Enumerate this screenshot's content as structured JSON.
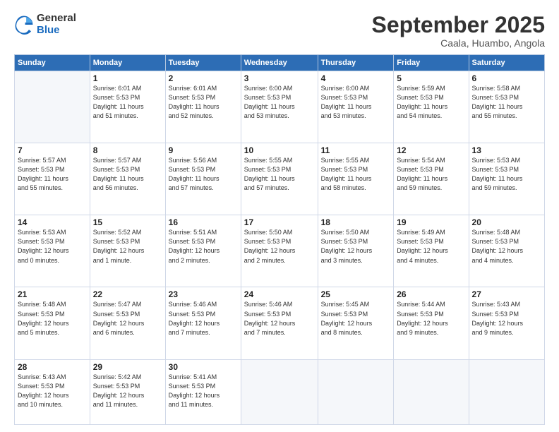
{
  "logo": {
    "general": "General",
    "blue": "Blue"
  },
  "title": "September 2025",
  "subtitle": "Caala, Huambo, Angola",
  "days_of_week": [
    "Sunday",
    "Monday",
    "Tuesday",
    "Wednesday",
    "Thursday",
    "Friday",
    "Saturday"
  ],
  "weeks": [
    [
      {
        "day": "",
        "info": ""
      },
      {
        "day": "1",
        "info": "Sunrise: 6:01 AM\nSunset: 5:53 PM\nDaylight: 11 hours\nand 51 minutes."
      },
      {
        "day": "2",
        "info": "Sunrise: 6:01 AM\nSunset: 5:53 PM\nDaylight: 11 hours\nand 52 minutes."
      },
      {
        "day": "3",
        "info": "Sunrise: 6:00 AM\nSunset: 5:53 PM\nDaylight: 11 hours\nand 53 minutes."
      },
      {
        "day": "4",
        "info": "Sunrise: 6:00 AM\nSunset: 5:53 PM\nDaylight: 11 hours\nand 53 minutes."
      },
      {
        "day": "5",
        "info": "Sunrise: 5:59 AM\nSunset: 5:53 PM\nDaylight: 11 hours\nand 54 minutes."
      },
      {
        "day": "6",
        "info": "Sunrise: 5:58 AM\nSunset: 5:53 PM\nDaylight: 11 hours\nand 55 minutes."
      }
    ],
    [
      {
        "day": "7",
        "info": "Sunrise: 5:57 AM\nSunset: 5:53 PM\nDaylight: 11 hours\nand 55 minutes."
      },
      {
        "day": "8",
        "info": "Sunrise: 5:57 AM\nSunset: 5:53 PM\nDaylight: 11 hours\nand 56 minutes."
      },
      {
        "day": "9",
        "info": "Sunrise: 5:56 AM\nSunset: 5:53 PM\nDaylight: 11 hours\nand 57 minutes."
      },
      {
        "day": "10",
        "info": "Sunrise: 5:55 AM\nSunset: 5:53 PM\nDaylight: 11 hours\nand 57 minutes."
      },
      {
        "day": "11",
        "info": "Sunrise: 5:55 AM\nSunset: 5:53 PM\nDaylight: 11 hours\nand 58 minutes."
      },
      {
        "day": "12",
        "info": "Sunrise: 5:54 AM\nSunset: 5:53 PM\nDaylight: 11 hours\nand 59 minutes."
      },
      {
        "day": "13",
        "info": "Sunrise: 5:53 AM\nSunset: 5:53 PM\nDaylight: 11 hours\nand 59 minutes."
      }
    ],
    [
      {
        "day": "14",
        "info": "Sunrise: 5:53 AM\nSunset: 5:53 PM\nDaylight: 12 hours\nand 0 minutes."
      },
      {
        "day": "15",
        "info": "Sunrise: 5:52 AM\nSunset: 5:53 PM\nDaylight: 12 hours\nand 1 minute."
      },
      {
        "day": "16",
        "info": "Sunrise: 5:51 AM\nSunset: 5:53 PM\nDaylight: 12 hours\nand 2 minutes."
      },
      {
        "day": "17",
        "info": "Sunrise: 5:50 AM\nSunset: 5:53 PM\nDaylight: 12 hours\nand 2 minutes."
      },
      {
        "day": "18",
        "info": "Sunrise: 5:50 AM\nSunset: 5:53 PM\nDaylight: 12 hours\nand 3 minutes."
      },
      {
        "day": "19",
        "info": "Sunrise: 5:49 AM\nSunset: 5:53 PM\nDaylight: 12 hours\nand 4 minutes."
      },
      {
        "day": "20",
        "info": "Sunrise: 5:48 AM\nSunset: 5:53 PM\nDaylight: 12 hours\nand 4 minutes."
      }
    ],
    [
      {
        "day": "21",
        "info": "Sunrise: 5:48 AM\nSunset: 5:53 PM\nDaylight: 12 hours\nand 5 minutes."
      },
      {
        "day": "22",
        "info": "Sunrise: 5:47 AM\nSunset: 5:53 PM\nDaylight: 12 hours\nand 6 minutes."
      },
      {
        "day": "23",
        "info": "Sunrise: 5:46 AM\nSunset: 5:53 PM\nDaylight: 12 hours\nand 7 minutes."
      },
      {
        "day": "24",
        "info": "Sunrise: 5:46 AM\nSunset: 5:53 PM\nDaylight: 12 hours\nand 7 minutes."
      },
      {
        "day": "25",
        "info": "Sunrise: 5:45 AM\nSunset: 5:53 PM\nDaylight: 12 hours\nand 8 minutes."
      },
      {
        "day": "26",
        "info": "Sunrise: 5:44 AM\nSunset: 5:53 PM\nDaylight: 12 hours\nand 9 minutes."
      },
      {
        "day": "27",
        "info": "Sunrise: 5:43 AM\nSunset: 5:53 PM\nDaylight: 12 hours\nand 9 minutes."
      }
    ],
    [
      {
        "day": "28",
        "info": "Sunrise: 5:43 AM\nSunset: 5:53 PM\nDaylight: 12 hours\nand 10 minutes."
      },
      {
        "day": "29",
        "info": "Sunrise: 5:42 AM\nSunset: 5:53 PM\nDaylight: 12 hours\nand 11 minutes."
      },
      {
        "day": "30",
        "info": "Sunrise: 5:41 AM\nSunset: 5:53 PM\nDaylight: 12 hours\nand 11 minutes."
      },
      {
        "day": "",
        "info": ""
      },
      {
        "day": "",
        "info": ""
      },
      {
        "day": "",
        "info": ""
      },
      {
        "day": "",
        "info": ""
      }
    ]
  ]
}
